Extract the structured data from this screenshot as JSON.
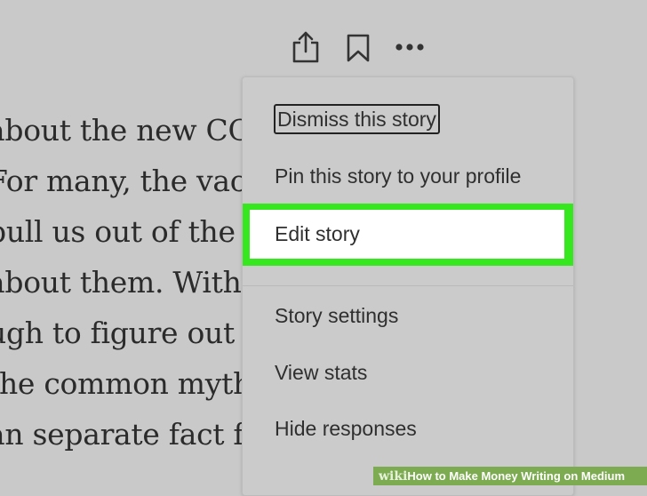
{
  "toolbar": {
    "icons": [
      "share-icon",
      "bookmark-icon",
      "more-icon"
    ]
  },
  "article": {
    "lines": [
      "about the new COVID",
      "For many, the vaccine",
      "pull us out of the pa",
      "about them. With son",
      "ugh to figure out wh",
      "the common myths",
      "an separate fact fron"
    ]
  },
  "menu": {
    "dismiss_label": "Dismiss this story",
    "pin_label": "Pin this story to your profile",
    "edit_label": "Edit story",
    "settings_label": "Story settings",
    "stats_label": "View stats",
    "hide_label": "Hide responses"
  },
  "colors": {
    "highlight": "#36e61f",
    "background": "#c9c9c9"
  },
  "watermark": {
    "prefix": "wiki",
    "bold": "How",
    "rest": " to Make Money Writing on Medium"
  }
}
